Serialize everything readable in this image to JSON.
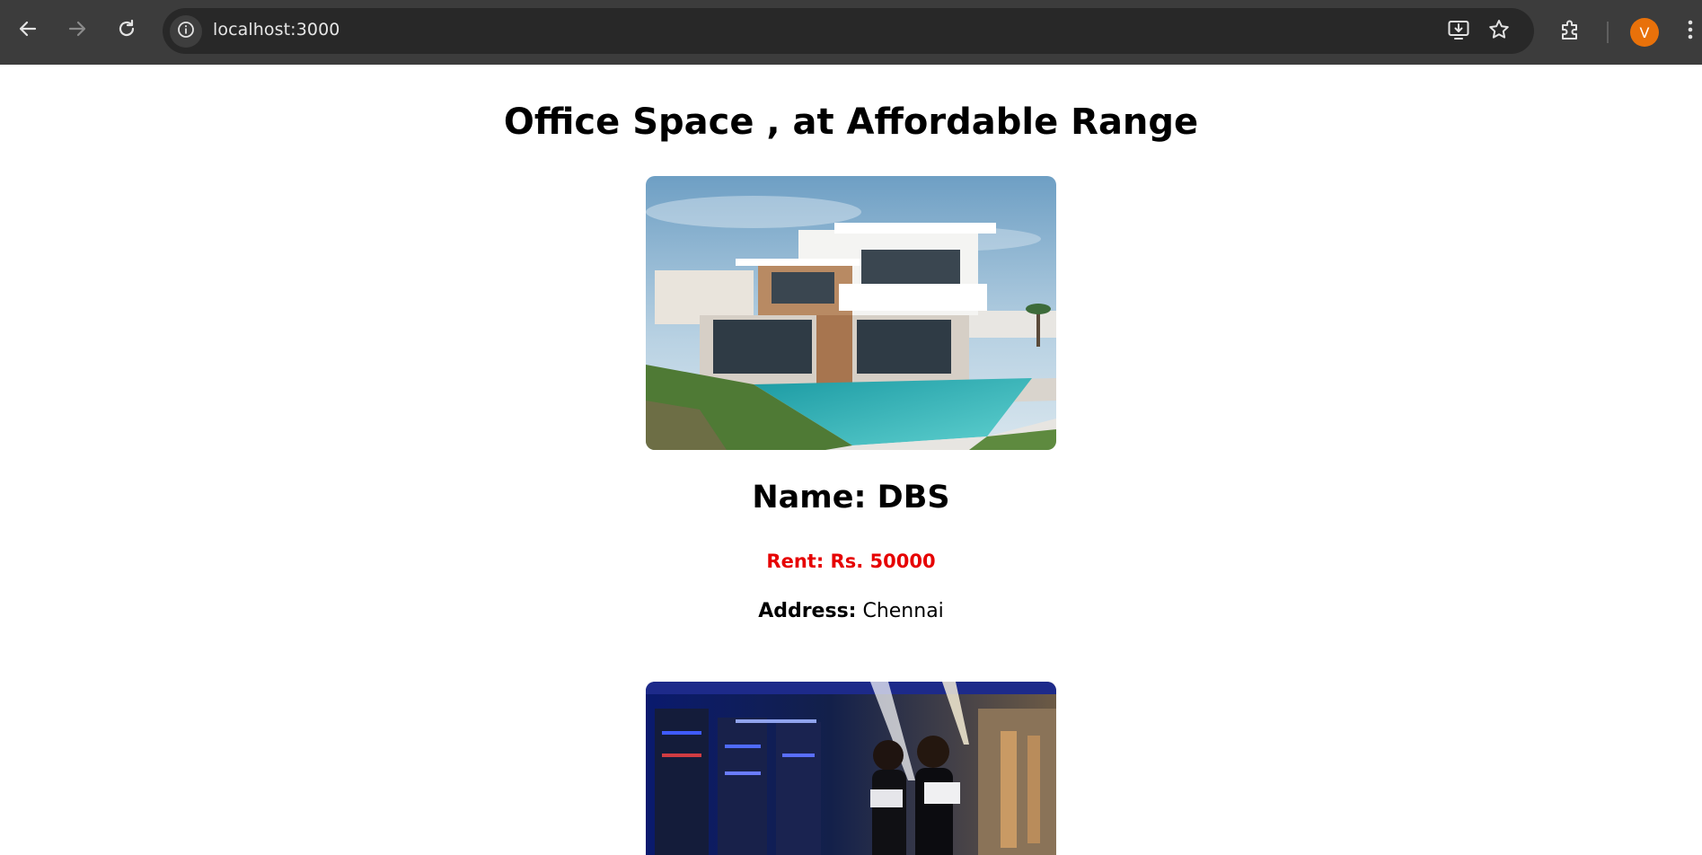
{
  "browser": {
    "url": "localhost:3000",
    "profile_initial": "V",
    "icons": {
      "back": "arrow-left-icon",
      "forward": "arrow-right-icon",
      "reload": "reload-icon",
      "site_info": "info-icon",
      "install": "install-app-icon",
      "bookmark": "star-icon",
      "extensions": "puzzle-icon",
      "menu": "kebab-menu-icon"
    },
    "colors": {
      "avatar": "#e8710a",
      "chrome": "#3c3c3c",
      "omnibox": "#282828"
    }
  },
  "page": {
    "title": "Office Space , at Affordable Range",
    "listings": [
      {
        "name_label": "Name: DBS",
        "rent_label": "Rent: Rs. 50000",
        "address_key": "Address:",
        "address_value": "Chennai",
        "image": "modern-house-with-pool-photo"
      },
      {
        "image": "server-room-woman-with-laptop-photo"
      }
    ],
    "colors": {
      "rent": "#e60000"
    }
  }
}
